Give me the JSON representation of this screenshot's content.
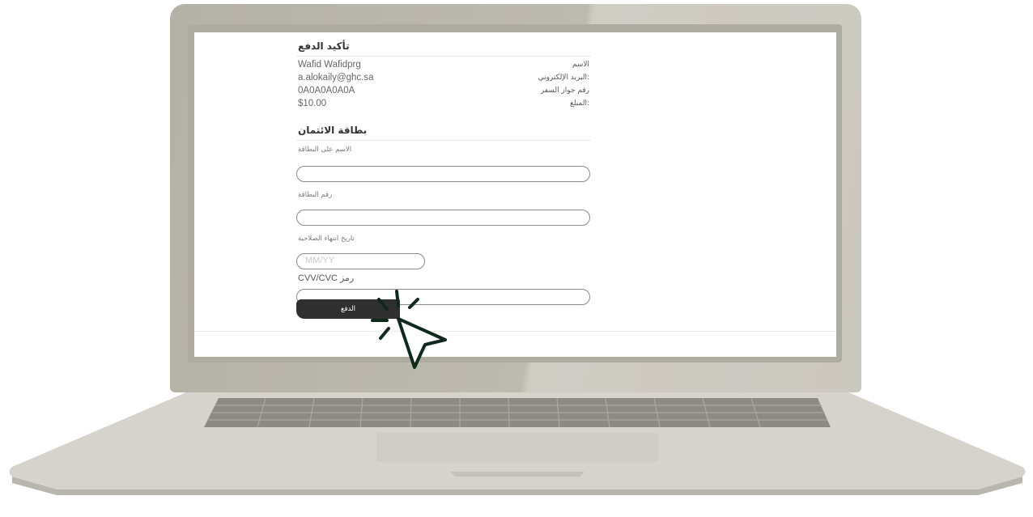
{
  "payment_confirmation": {
    "title": "تأكيد الدفع",
    "rows": [
      {
        "label": "الاسم",
        "value": "Wafid Wafidprg"
      },
      {
        "label": ":البريد الإلكتروني",
        "value": "a.alokaily@ghc.sa"
      },
      {
        "label": "رقم جواز السفر",
        "value": "0A0A0A0A0A"
      },
      {
        "label": ":المبلغ",
        "value": "$10.00"
      }
    ]
  },
  "credit_card": {
    "title": "بطاقة الائتمان",
    "name_on_card_label": "الاسم على البطاقة",
    "name_on_card_value": "",
    "card_number_label": "رقم البطاقة",
    "card_number_value": "",
    "expiry_label": "تاريخ انتهاء الصلاحية",
    "expiry_placeholder": "MM/YY",
    "cvv_label": "رمز CVV/CVC",
    "cvv_value": ""
  },
  "pay_button_label": "الدفع",
  "colors": {
    "button_bg": "#2f2f2f",
    "cursor": "#0f2a1c",
    "laptop_body": "#bcb9af"
  },
  "icons": {
    "cursor": "click-cursor-icon"
  }
}
